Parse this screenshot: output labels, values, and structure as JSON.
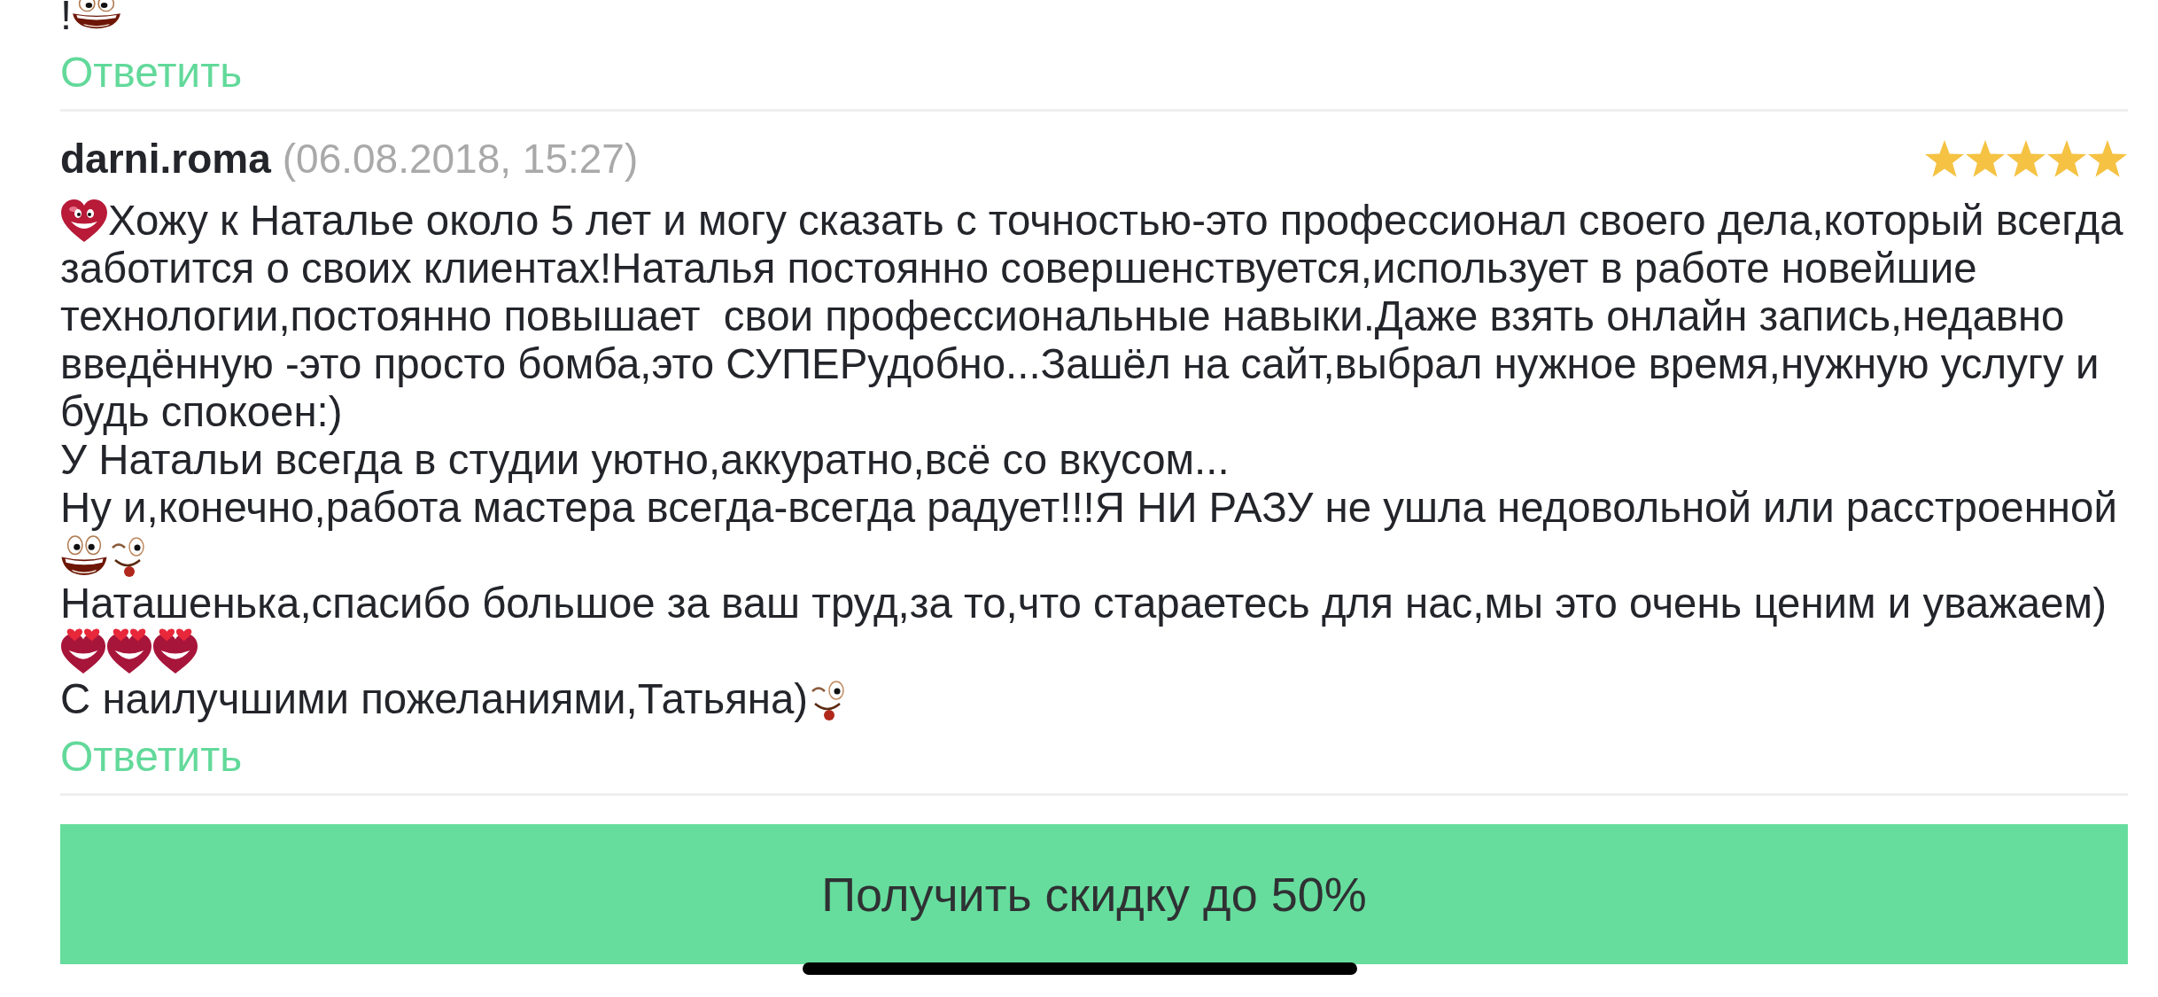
{
  "previous_comment": {
    "tail": [
      {
        "kind": "text",
        "text": "!"
      },
      {
        "kind": "grin"
      }
    ],
    "reply_link": "Ответить"
  },
  "comment": {
    "author": "darni.roma",
    "date": "(06.08.2018, 15:27)",
    "stars": 5,
    "body": [
      {
        "pieces": [
          {
            "kind": "heart"
          },
          {
            "kind": "text",
            "text": "Хожу к Наталье около 5 лет и могу сказать с точностью-это профессионал своего дела,который всегда"
          }
        ]
      },
      {
        "pieces": [
          {
            "kind": "text",
            "text": "заботится о своих клиентах!Наталья постоянно совершенствуется,использует в работе новейшие технологии,постоянно повышает  свои профессиональные навыки.Даже взять онлайн запись,недавно введённую -это просто бомба,это СУПЕРудобно...Зашёл на сайт,выбрал нужное время,нужную услугу и будь спокоен:)"
          }
        ]
      },
      {
        "pieces": [
          {
            "kind": "text",
            "text": "У Натальи всегда в студии уютно,аккуратно,всё со вкусом..."
          }
        ]
      },
      {
        "pieces": [
          {
            "kind": "text",
            "text": "Ну и,конечно,работа мастера всегда-всегда радует!!!Я НИ РАЗУ не ушла недовольной или расстроенной"
          }
        ]
      },
      {
        "pieces": [
          {
            "kind": "grin"
          },
          {
            "kind": "wink"
          }
        ]
      },
      {
        "pieces": [
          {
            "kind": "text",
            "text": "Наташенька,спасибо большое за ваш труд,за то,что стараетесь для нас,мы это очень ценим и уважаем)"
          }
        ]
      },
      {
        "pieces": [
          {
            "kind": "love"
          },
          {
            "kind": "love"
          },
          {
            "kind": "love"
          }
        ]
      },
      {
        "pieces": [
          {
            "kind": "text",
            "text": "С наилучшими пожеланиями,Татьяна)"
          },
          {
            "kind": "wink"
          }
        ]
      }
    ],
    "reply_link": "Ответить"
  },
  "discount_button": "Получить скидку до 50%"
}
